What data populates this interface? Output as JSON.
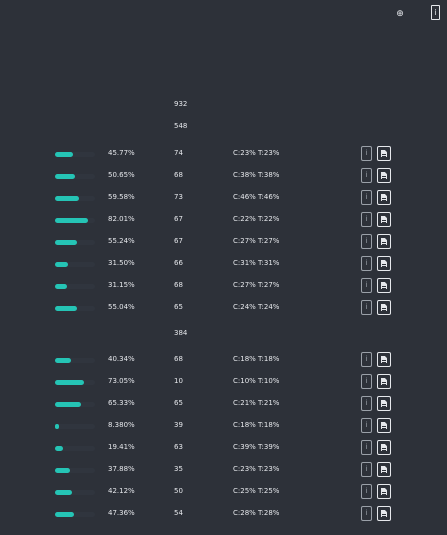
{
  "header": {
    "crosshair_icon": "crosshair-icon",
    "info_icon": "info-icon",
    "info_glyph": "i"
  },
  "summary": {
    "total": "932"
  },
  "groups": [
    {
      "total": "548",
      "rows": [
        {
          "percent": "45.77%",
          "fill": 0.4577,
          "count": "74",
          "ct": "C:23%  T:23%"
        },
        {
          "percent": "50.65%",
          "fill": 0.5065,
          "count": "68",
          "ct": "C:38%  T:38%"
        },
        {
          "percent": "59.58%",
          "fill": 0.5958,
          "count": "73",
          "ct": "C:46%  T:46%"
        },
        {
          "percent": "82.01%",
          "fill": 0.8201,
          "count": "67",
          "ct": "C:22%  T:22%"
        },
        {
          "percent": "55.24%",
          "fill": 0.5524,
          "count": "67",
          "ct": "C:27%  T:27%"
        },
        {
          "percent": "31.50%",
          "fill": 0.315,
          "count": "66",
          "ct": "C:31%  T:31%"
        },
        {
          "percent": "31.15%",
          "fill": 0.3115,
          "count": "68",
          "ct": "C:27%  T:27%"
        },
        {
          "percent": "55.04%",
          "fill": 0.5504,
          "count": "65",
          "ct": "C:24%  T:24%"
        }
      ]
    },
    {
      "total": "384",
      "rows": [
        {
          "percent": "40.34%",
          "fill": 0.4034,
          "count": "68",
          "ct": "C:18%  T:18%"
        },
        {
          "percent": "73.05%",
          "fill": 0.7305,
          "count": "10",
          "ct": "C:10%  T:10%"
        },
        {
          "percent": "65.33%",
          "fill": 0.6533,
          "count": "65",
          "ct": "C:21%  T:21%"
        },
        {
          "percent": "8.380%",
          "fill": 0.0838,
          "count": "39",
          "ct": "C:18%  T:18%"
        },
        {
          "percent": "19.41%",
          "fill": 0.1941,
          "count": "63",
          "ct": "C:39%  T:39%"
        },
        {
          "percent": "37.88%",
          "fill": 0.3788,
          "count": "35",
          "ct": "C:23%  T:23%"
        },
        {
          "percent": "42.12%",
          "fill": 0.4212,
          "count": "50",
          "ct": "C:25%  T:25%"
        },
        {
          "percent": "47.36%",
          "fill": 0.4736,
          "count": "54",
          "ct": "C:28%  T:28%"
        }
      ]
    }
  ],
  "row_actions": {
    "info_glyph": "i",
    "info_icon": "info-icon",
    "doc_icon": "document-icon"
  },
  "colors": {
    "background": "#2d3139",
    "bar_fill": "#25c4b5",
    "bar_track": "#30353e",
    "text": "#e6e8ec",
    "muted": "#9aa0a8"
  }
}
